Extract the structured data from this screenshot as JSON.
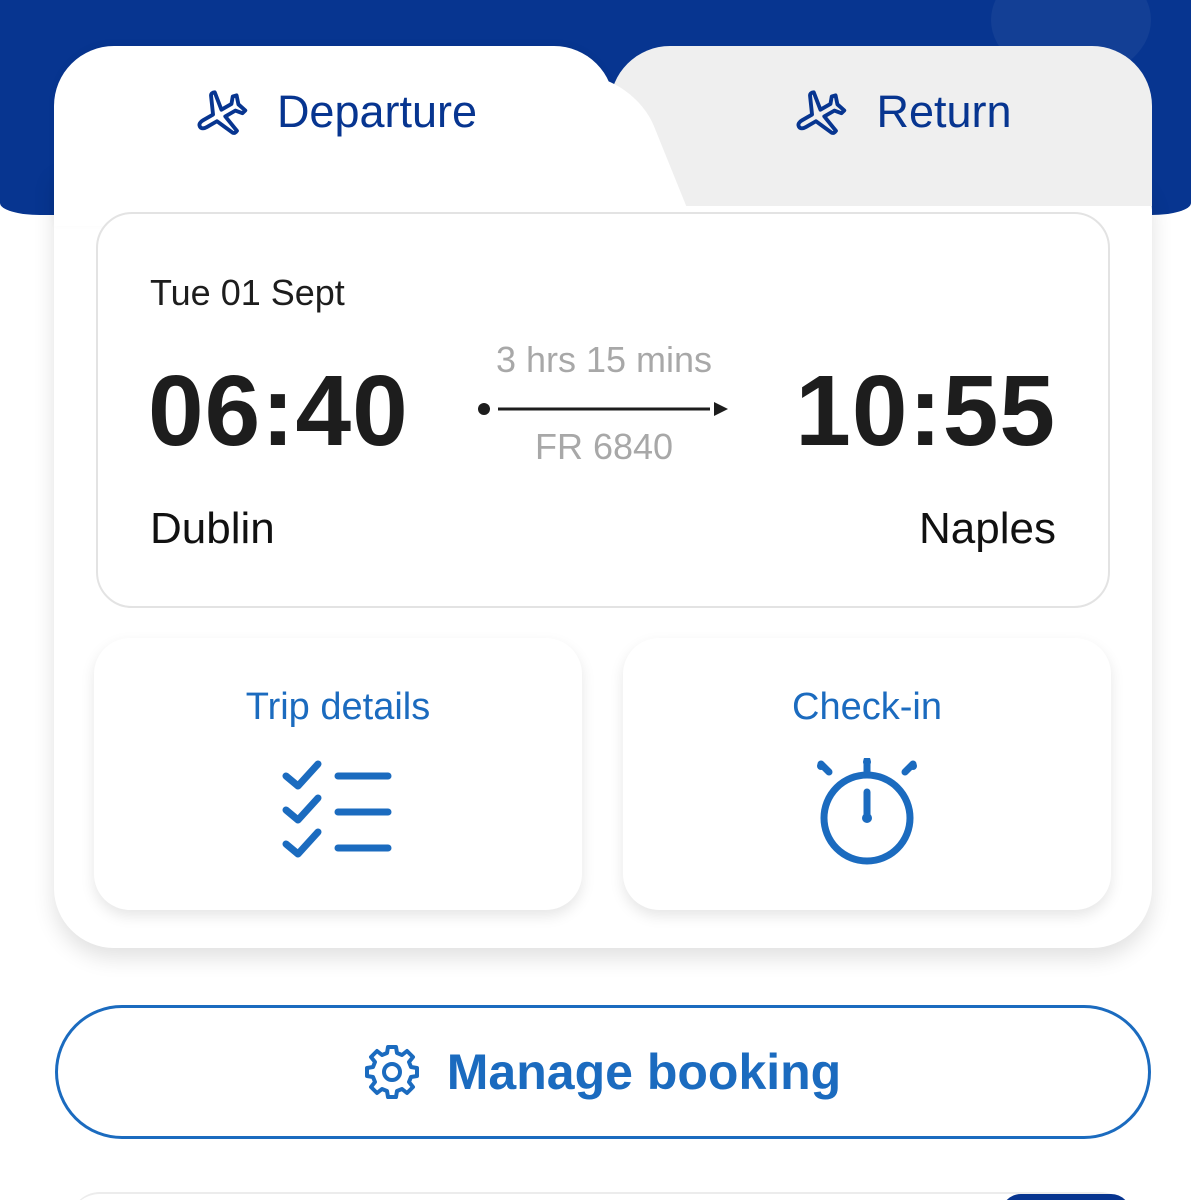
{
  "colors": {
    "brand_navy": "#073590",
    "accent_blue": "#1b6bbf",
    "muted_text": "#a8a8a8"
  },
  "tabs": [
    {
      "label": "Departure",
      "icon": "plane-icon",
      "selected": true
    },
    {
      "label": "Return",
      "icon": "plane-icon",
      "selected": false
    }
  ],
  "flight": {
    "date": "Tue 01 Sept",
    "departure_time": "06:40",
    "arrival_time": "10:55",
    "duration": "3 hrs 15 mins",
    "flight_number": "FR 6840",
    "origin": "Dublin",
    "destination": "Naples"
  },
  "actions": {
    "trip_details": {
      "label": "Trip details",
      "icon": "checklist-icon"
    },
    "check_in": {
      "label": "Check-in",
      "icon": "stopwatch-icon"
    }
  },
  "manage_booking": {
    "label": "Manage booking",
    "icon": "gear-icon"
  }
}
